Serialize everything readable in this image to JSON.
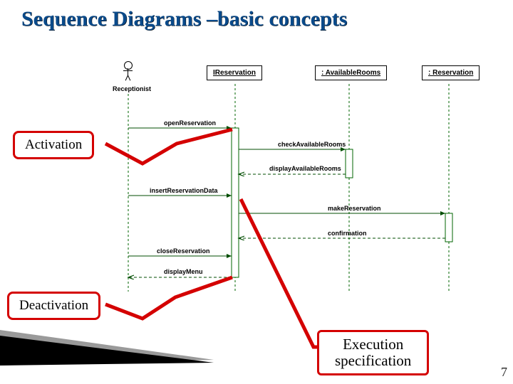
{
  "title": "Sequence Diagrams –basic concepts",
  "actor": "Receptionist",
  "objects": {
    "o1": "IReservation",
    "o2": ": AvailableRooms",
    "o3": ": Reservation"
  },
  "messages": {
    "m1": "openReservation",
    "m2": "checkAvailableRooms",
    "m3": "displayAvailableRooms",
    "m4": "insertReservationData",
    "m5": "makeReservation",
    "m6": "confirmation",
    "m7": "closeReservation",
    "m8": "displayMenu"
  },
  "callouts": {
    "activation": "Activation",
    "deactivation": "Deactivation",
    "exec": "Execution\nspecification"
  },
  "page_number": "7"
}
